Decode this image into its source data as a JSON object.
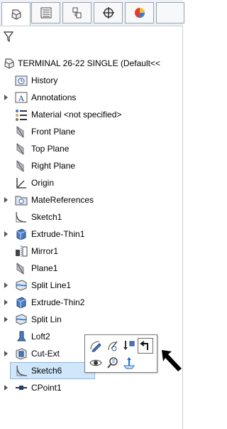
{
  "tabs": [
    {
      "name": "featuremanager-icon"
    },
    {
      "name": "propertymanager-icon"
    },
    {
      "name": "configurationmanager-icon"
    },
    {
      "name": "dimxpert-icon"
    },
    {
      "name": "display-manager-icon"
    }
  ],
  "root": {
    "label": "TERMINAL 26-22 SINGLE  (Default<<"
  },
  "items": [
    {
      "label": "History"
    },
    {
      "label": "Annotations"
    },
    {
      "label": "Material <not specified>"
    },
    {
      "label": "Front Plane"
    },
    {
      "label": "Top Plane"
    },
    {
      "label": "Right Plane"
    },
    {
      "label": "Origin"
    },
    {
      "label": "MateReferences"
    },
    {
      "label": "Sketch1"
    },
    {
      "label": "Extrude-Thin1"
    },
    {
      "label": "Mirror1"
    },
    {
      "label": "Plane1"
    },
    {
      "label": "Split Line1"
    },
    {
      "label": "Extrude-Thin2"
    },
    {
      "label": "Split Lin"
    },
    {
      "label": "Loft2"
    },
    {
      "label": "Cut-Ext"
    },
    {
      "label": "Sketch6"
    },
    {
      "label": "CPoint1"
    }
  ],
  "colors": {
    "accent": "#1a6fc9",
    "selection": "#cfe6fb"
  }
}
